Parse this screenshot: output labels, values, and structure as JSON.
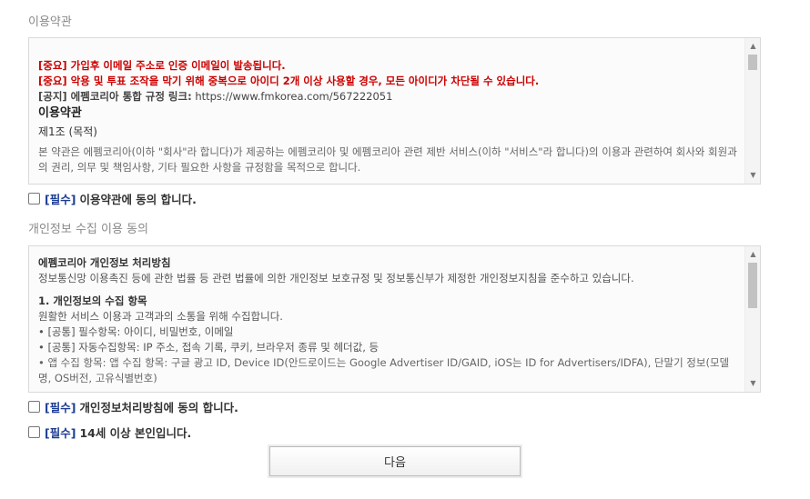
{
  "terms": {
    "title": "이용약관",
    "content": {
      "notice1": "[중요] 가입후 이메일 주소로 인증 이메일이 발송됩니다.",
      "notice2": "[중요] 악용 및 투표 조작을 막기 위해 중복으로 아이디 2개 이상 사용할 경우, 모든 아이디가 차단될 수 있습니다.",
      "notice3_label": "[공지] 에펨코리아 통합 규정 링크:",
      "notice3_link": "https://www.fmkorea.com/567222051",
      "heading": "이용약관",
      "article": "제1조 (목적)",
      "body": "본 약관은 에펨코리아(이하 \"회사\"라 합니다)가 제공하는 에펨코리아 및 에펨코리아 관련 제반 서비스(이하 \"서비스\"라 합니다)의 이용과 관련하여 회사와 회원과의 권리, 의무 및 책임사항, 기타 필요한 사항을 규정함을 목적으로 합니다."
    },
    "agree": {
      "required": "[필수]",
      "label": "이용약관에 동의 합니다."
    }
  },
  "privacy": {
    "title": "개인정보 수집 이용 동의",
    "content": {
      "heading": "에펨코리아 개인정보 처리방침",
      "intro": "정보통신망 이용촉진 등에 관한 법률 등 관련 법률에 의한 개인정보 보호규정 및 정보통신부가 제정한 개인정보지침을 준수하고 있습니다.",
      "section1_title": "1. 개인정보의 수집 항목",
      "section1_desc": "원활한 서비스 이용과 고객과의 소통을 위해 수집합니다.",
      "items": [
        "• [공통] 필수항목: 아이디, 비밀번호, 이메일",
        "• [공통] 자동수집항목: IP 주소, 접속 기록, 쿠키, 브라우저 종류 및 헤더값, 등",
        "• 앱 수집 항목: 앱 수집 항목: 구글 광고 ID, Device ID(안드로이드는 Google Advertiser ID/GAID, iOS는 ID for Advertisers/IDFA), 단말기 정보(모델명, OS버전, 고유식별번호)"
      ]
    },
    "agree": {
      "required": "[필수]",
      "label": "개인정보처리방침에 동의 합니다."
    }
  },
  "age": {
    "required": "[필수]",
    "label": "14세 이상 본인입니다."
  },
  "next_button": "다음"
}
